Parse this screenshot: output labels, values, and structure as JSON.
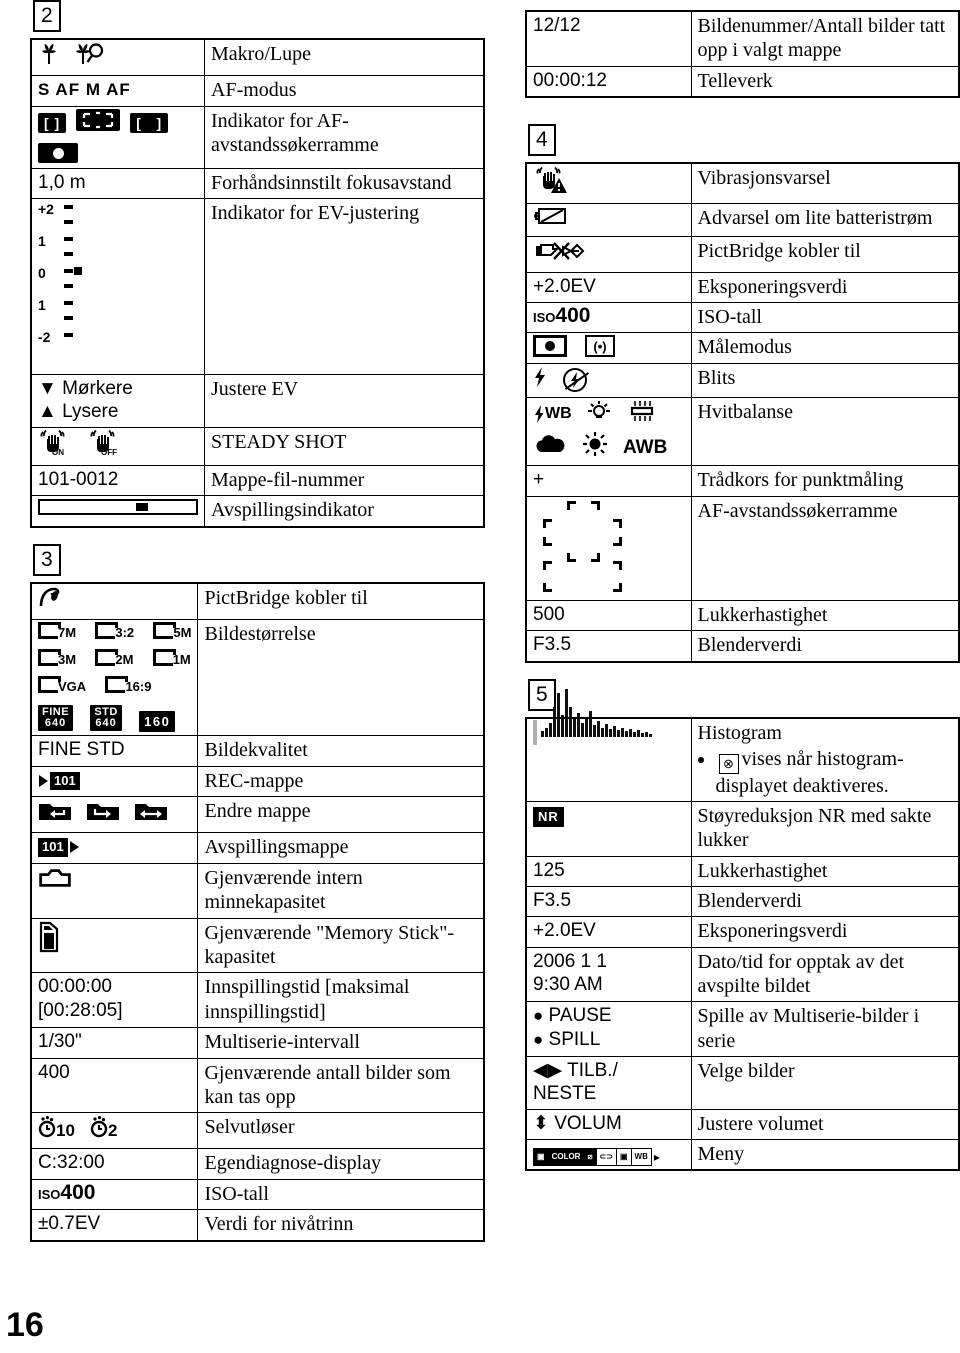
{
  "page": {
    "folio": "16"
  },
  "sections": {
    "s2": {
      "number": "2",
      "rows": [
        {
          "symbol_icons": [
            "macro-tulip-icon",
            "magnify-tulip-icon"
          ],
          "symbol_text": "",
          "desc": "Makro/Lupe"
        },
        {
          "symbol_text": "S AF  M AF",
          "desc": "AF-modus"
        },
        {
          "symbol_icons": [
            "af-frame-bracket-icon",
            "af-frame-dashed-icon",
            "af-frame-wide-icon",
            "af-lock-dot-icon"
          ],
          "symbol_text": "",
          "desc": "Indikator for AF-avstandssøkerramme"
        },
        {
          "symbol_text": "1,0 m",
          "desc": "Forhåndsinnstilt fokusavstand"
        },
        {
          "symbol_icons": [
            "ev-scale-icon"
          ],
          "symbol_text": "",
          "ev_labels": [
            "+2",
            "1",
            "0",
            "1",
            "-2"
          ],
          "desc": "Indikator for EV-justering"
        },
        {
          "symbol_text": "▼ Mørkere\n▲ Lysere",
          "desc": "Justere EV"
        },
        {
          "symbol_icons": [
            "steady-shot-on-icon",
            "steady-shot-off-icon"
          ],
          "symbol_text": "ON  OFF",
          "desc": "STEADY SHOT"
        },
        {
          "symbol_text": "101-0012",
          "desc": "Mappe-fil-nummer"
        },
        {
          "symbol_icons": [
            "playback-bar-icon"
          ],
          "symbol_text": "",
          "desc": "Avspillingsindikator"
        }
      ]
    },
    "s3": {
      "number": "3",
      "rows": [
        {
          "symbol_icons": [
            "pictbridge-connect-icon"
          ],
          "symbol_text": "",
          "desc": "PictBridge kobler til"
        },
        {
          "symbol_icons": [
            "image-size-icon"
          ],
          "sizes": [
            "7M",
            "3:2",
            "5M",
            "3M",
            "2M",
            "1M",
            "VGA",
            "16:9"
          ],
          "movie_sizes": [
            "FINE 640",
            "STD 640",
            "160"
          ],
          "desc": "Bildestørrelse"
        },
        {
          "symbol_text": "FINE STD",
          "desc": "Bildekvalitet"
        },
        {
          "symbol_icons": [
            "rec-folder-icon"
          ],
          "symbol_text": "101",
          "desc": "REC-mappe"
        },
        {
          "symbol_icons": [
            "folder-back-icon",
            "folder-next-icon",
            "folder-change-icon"
          ],
          "symbol_text": "",
          "desc": "Endre mappe"
        },
        {
          "symbol_icons": [
            "playback-folder-icon"
          ],
          "symbol_text": "101",
          "desc": "Avspillingsmappe"
        },
        {
          "symbol_icons": [
            "internal-memory-icon"
          ],
          "symbol_text": "",
          "desc": "Gjenværende intern minnekapasitet"
        },
        {
          "symbol_icons": [
            "memory-stick-icon"
          ],
          "symbol_text": "",
          "desc": "Gjenværende \"Memory Stick\"-kapasitet"
        },
        {
          "symbol_text": "00:00:00\n[00:28:05]",
          "desc": "Innspillingstid [maksimal innspillingstid]"
        },
        {
          "symbol_text": "1/30\"",
          "desc": "Multiserie-intervall"
        },
        {
          "symbol_text": "400",
          "desc": "Gjenværende antall bilder som kan tas opp"
        },
        {
          "symbol_icons": [
            "self-timer-10-icon",
            "self-timer-2-icon"
          ],
          "symbol_text": "10   2",
          "desc": "Selvutløser"
        },
        {
          "symbol_text": "C:32:00",
          "desc": "Egendiagnose-display"
        },
        {
          "symbol_icons": [
            "iso-icon"
          ],
          "symbol_text": "ISO400",
          "desc": "ISO-tall"
        },
        {
          "symbol_text": "±0.7EV",
          "desc": "Verdi for nivåtrinn"
        }
      ]
    },
    "s_top_right": {
      "rows": [
        {
          "symbol_text": "12/12",
          "desc": "Bildenummer/Antall bilder tatt opp i valgt mappe"
        },
        {
          "symbol_text": "00:00:12",
          "desc": "Telleverk"
        }
      ]
    },
    "s4": {
      "number": "4",
      "rows": [
        {
          "symbol_icons": [
            "vibration-warning-icon"
          ],
          "symbol_text": "",
          "desc": "Vibrasjonsvarsel"
        },
        {
          "symbol_icons": [
            "low-battery-icon"
          ],
          "symbol_text": "",
          "desc": "Advarsel om lite batteristrøm"
        },
        {
          "symbol_icons": [
            "pictbridge-connecting-icon"
          ],
          "symbol_text": "",
          "desc": "PictBridge kobler til"
        },
        {
          "symbol_text": "+2.0EV",
          "desc": "Eksponeringsverdi"
        },
        {
          "symbol_icons": [
            "iso-icon"
          ],
          "symbol_text": "ISO400",
          "desc": "ISO-tall"
        },
        {
          "symbol_icons": [
            "spot-metering-icon",
            "multi-metering-icon"
          ],
          "symbol_text": "",
          "desc": "Målemodus"
        },
        {
          "symbol_icons": [
            "flash-on-icon",
            "flash-off-icon"
          ],
          "symbol_text": "",
          "desc": "Blits"
        },
        {
          "symbol_icons": [
            "wb-flash-icon",
            "wb-incandescent-icon",
            "wb-fluorescent-icon",
            "wb-cloudy-icon",
            "wb-daylight-icon",
            "wb-auto-icon"
          ],
          "symbol_text": "WB   AWB",
          "desc": "Hvitbalanse"
        },
        {
          "symbol_text": "+",
          "desc": "Trådkors for punktmåling"
        },
        {
          "symbol_icons": [
            "af-range-finder-frame-icon"
          ],
          "symbol_text": "",
          "desc": "AF-avstandssøkerramme"
        },
        {
          "symbol_text": "500",
          "desc": "Lukkerhastighet"
        },
        {
          "symbol_text": "F3.5",
          "desc": "Blenderverdi"
        }
      ]
    },
    "s5": {
      "number": "5",
      "rows": [
        {
          "symbol_icons": [
            "histogram-thumbnail-icon"
          ],
          "symbol_text": "",
          "desc": "Histogram",
          "note": "vises når histogram-displayet deaktiveres.",
          "note_icon": "histogram-off-icon"
        },
        {
          "symbol_icons": [
            "noise-reduction-icon"
          ],
          "symbol_text": "NR",
          "desc": "Støyreduksjon NR med sakte lukker"
        },
        {
          "symbol_text": "125",
          "desc": "Lukkerhastighet"
        },
        {
          "symbol_text": "F3.5",
          "desc": "Blenderverdi"
        },
        {
          "symbol_text": "+2.0EV",
          "desc": "Eksponeringsverdi"
        },
        {
          "symbol_text": "2006 1 1\n9:30 AM",
          "desc": "Dato/tid for opptak av det avspilte bildet"
        },
        {
          "symbol_text": "● PAUSE\n● SPILL",
          "desc": "Spille av Multiserie-bilder i serie"
        },
        {
          "symbol_text": "◀▶ TILB./\nNESTE",
          "desc": "Velge bilder"
        },
        {
          "symbol_text": "⬍ VOLUM",
          "desc": "Justere volumet"
        },
        {
          "symbol_icons": [
            "menu-bar-icon"
          ],
          "symbol_text": "",
          "menu_items": [
            "camera",
            "COLOR",
            "EV",
            "focus",
            "metering",
            "WB"
          ],
          "desc": "Meny"
        }
      ]
    }
  }
}
